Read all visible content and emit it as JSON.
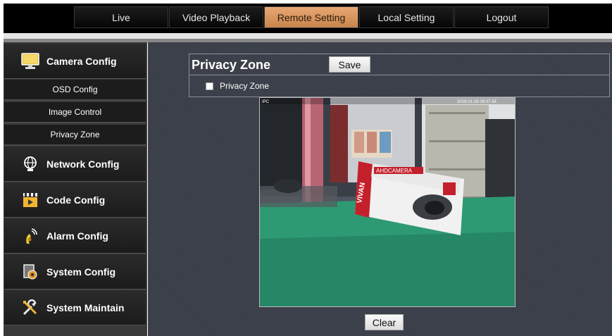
{
  "nav": {
    "tabs": [
      {
        "label": "Live"
      },
      {
        "label": "Video Playback"
      },
      {
        "label": "Remote Setting"
      },
      {
        "label": "Local Setting"
      },
      {
        "label": "Logout"
      }
    ],
    "active": "Remote Setting"
  },
  "sidebar": {
    "camera_config": "Camera Config",
    "sub_items": [
      {
        "label": "OSD Config"
      },
      {
        "label": "Image Control"
      },
      {
        "label": "Privacy Zone"
      }
    ],
    "network_config": "Network Config",
    "code_config": "Code Config",
    "alarm_config": "Alarm Config",
    "system_config": "System Config",
    "system_maintain": "System Maintain"
  },
  "main": {
    "title": "Privacy Zone",
    "save_label": "Save",
    "checkbox_label": "Privacy Zone",
    "checkbox_checked": false,
    "clear_label": "Clear",
    "video_overlay_timestamp": "2018-01-26 09:07:43",
    "video_overlay_channel": "IPC",
    "product_box_brand": "VIVAN",
    "product_box_title": "AHDCAMERA"
  },
  "colors": {
    "active_tab": "#d4915a",
    "main_bg": "#3a3e48",
    "sidebar_bg": "#1b1b1b"
  }
}
